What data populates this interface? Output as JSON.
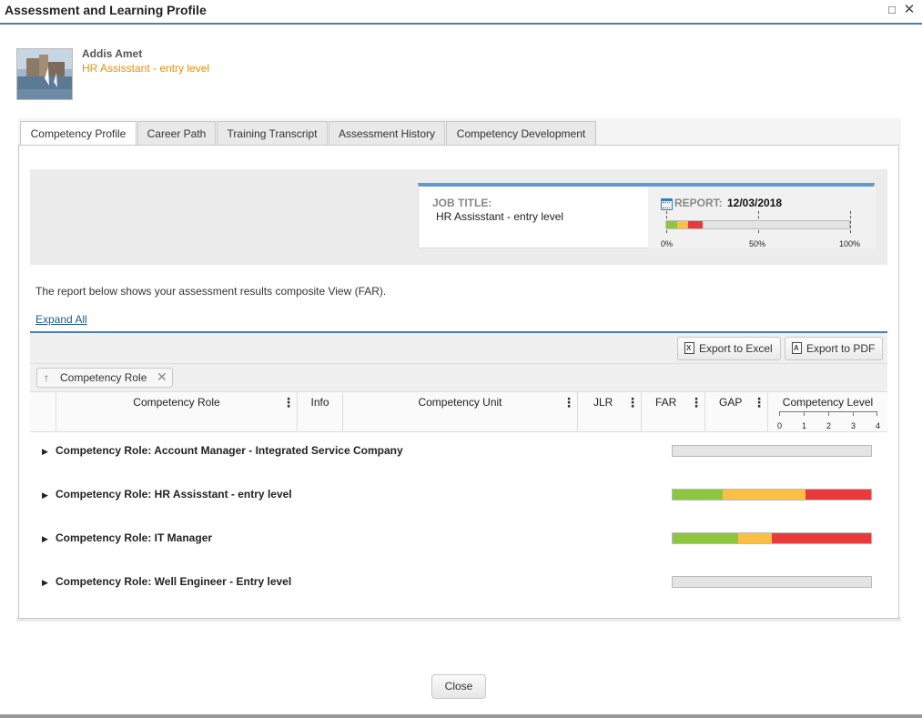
{
  "window": {
    "title": "Assessment and Learning Profile"
  },
  "user": {
    "name": "Addis Amet",
    "job": "HR Assisstant - entry level"
  },
  "tabs": [
    {
      "label": "Competency Profile",
      "active": true
    },
    {
      "label": "Career Path"
    },
    {
      "label": "Training Transcript"
    },
    {
      "label": "Assessment History"
    },
    {
      "label": "Competency Development"
    }
  ],
  "summary": {
    "job_title_label": "JOB TITLE:",
    "job_title_value": "HR Assisstant - entry level",
    "report_label": "REPORT:",
    "report_date": "12/03/2018",
    "progress_segments": [
      {
        "color": "#8dc63f",
        "fraction": 0.06
      },
      {
        "color": "#fbbf45",
        "fraction": 0.06
      },
      {
        "color": "#e83a3a",
        "fraction": 0.08
      }
    ],
    "scale_labels": [
      "0%",
      "50%",
      "100%"
    ]
  },
  "description": "The report below shows your assessment results composite View (FAR).",
  "expand_all": "Expand All",
  "toolbar": {
    "export_excel": "Export to Excel",
    "export_pdf": "Export to PDF"
  },
  "grouping": {
    "chip_label": "Competency Role"
  },
  "columns": {
    "competency_role": "Competency Role",
    "info": "Info",
    "competency_unit": "Competency Unit",
    "jlr": "JLR",
    "far": "FAR",
    "gap": "GAP",
    "competency_level": "Competency Level",
    "level_scale": [
      "0",
      "1",
      "2",
      "3",
      "4"
    ]
  },
  "groups": [
    {
      "label": "Competency Role: Account Manager - Integrated Service Company",
      "segments": []
    },
    {
      "label": "Competency Role: HR Assisstant - entry level",
      "segments": [
        {
          "color": "#8dc63f",
          "fraction": 0.25
        },
        {
          "color": "#fbbf45",
          "fraction": 0.42
        },
        {
          "color": "#e83a3a",
          "fraction": 0.33
        }
      ]
    },
    {
      "label": "Competency Role: IT Manager",
      "segments": [
        {
          "color": "#8dc63f",
          "fraction": 0.33
        },
        {
          "color": "#fbbf45",
          "fraction": 0.17
        },
        {
          "color": "#e83a3a",
          "fraction": 0.5
        }
      ]
    },
    {
      "label": "Competency Role: Well Engineer - Entry level",
      "segments": []
    }
  ],
  "footer": {
    "close_label": "Close"
  },
  "colors": {
    "accent": "#4a7fb5",
    "job_text": "#e8900c",
    "link": "#1a5a96"
  }
}
